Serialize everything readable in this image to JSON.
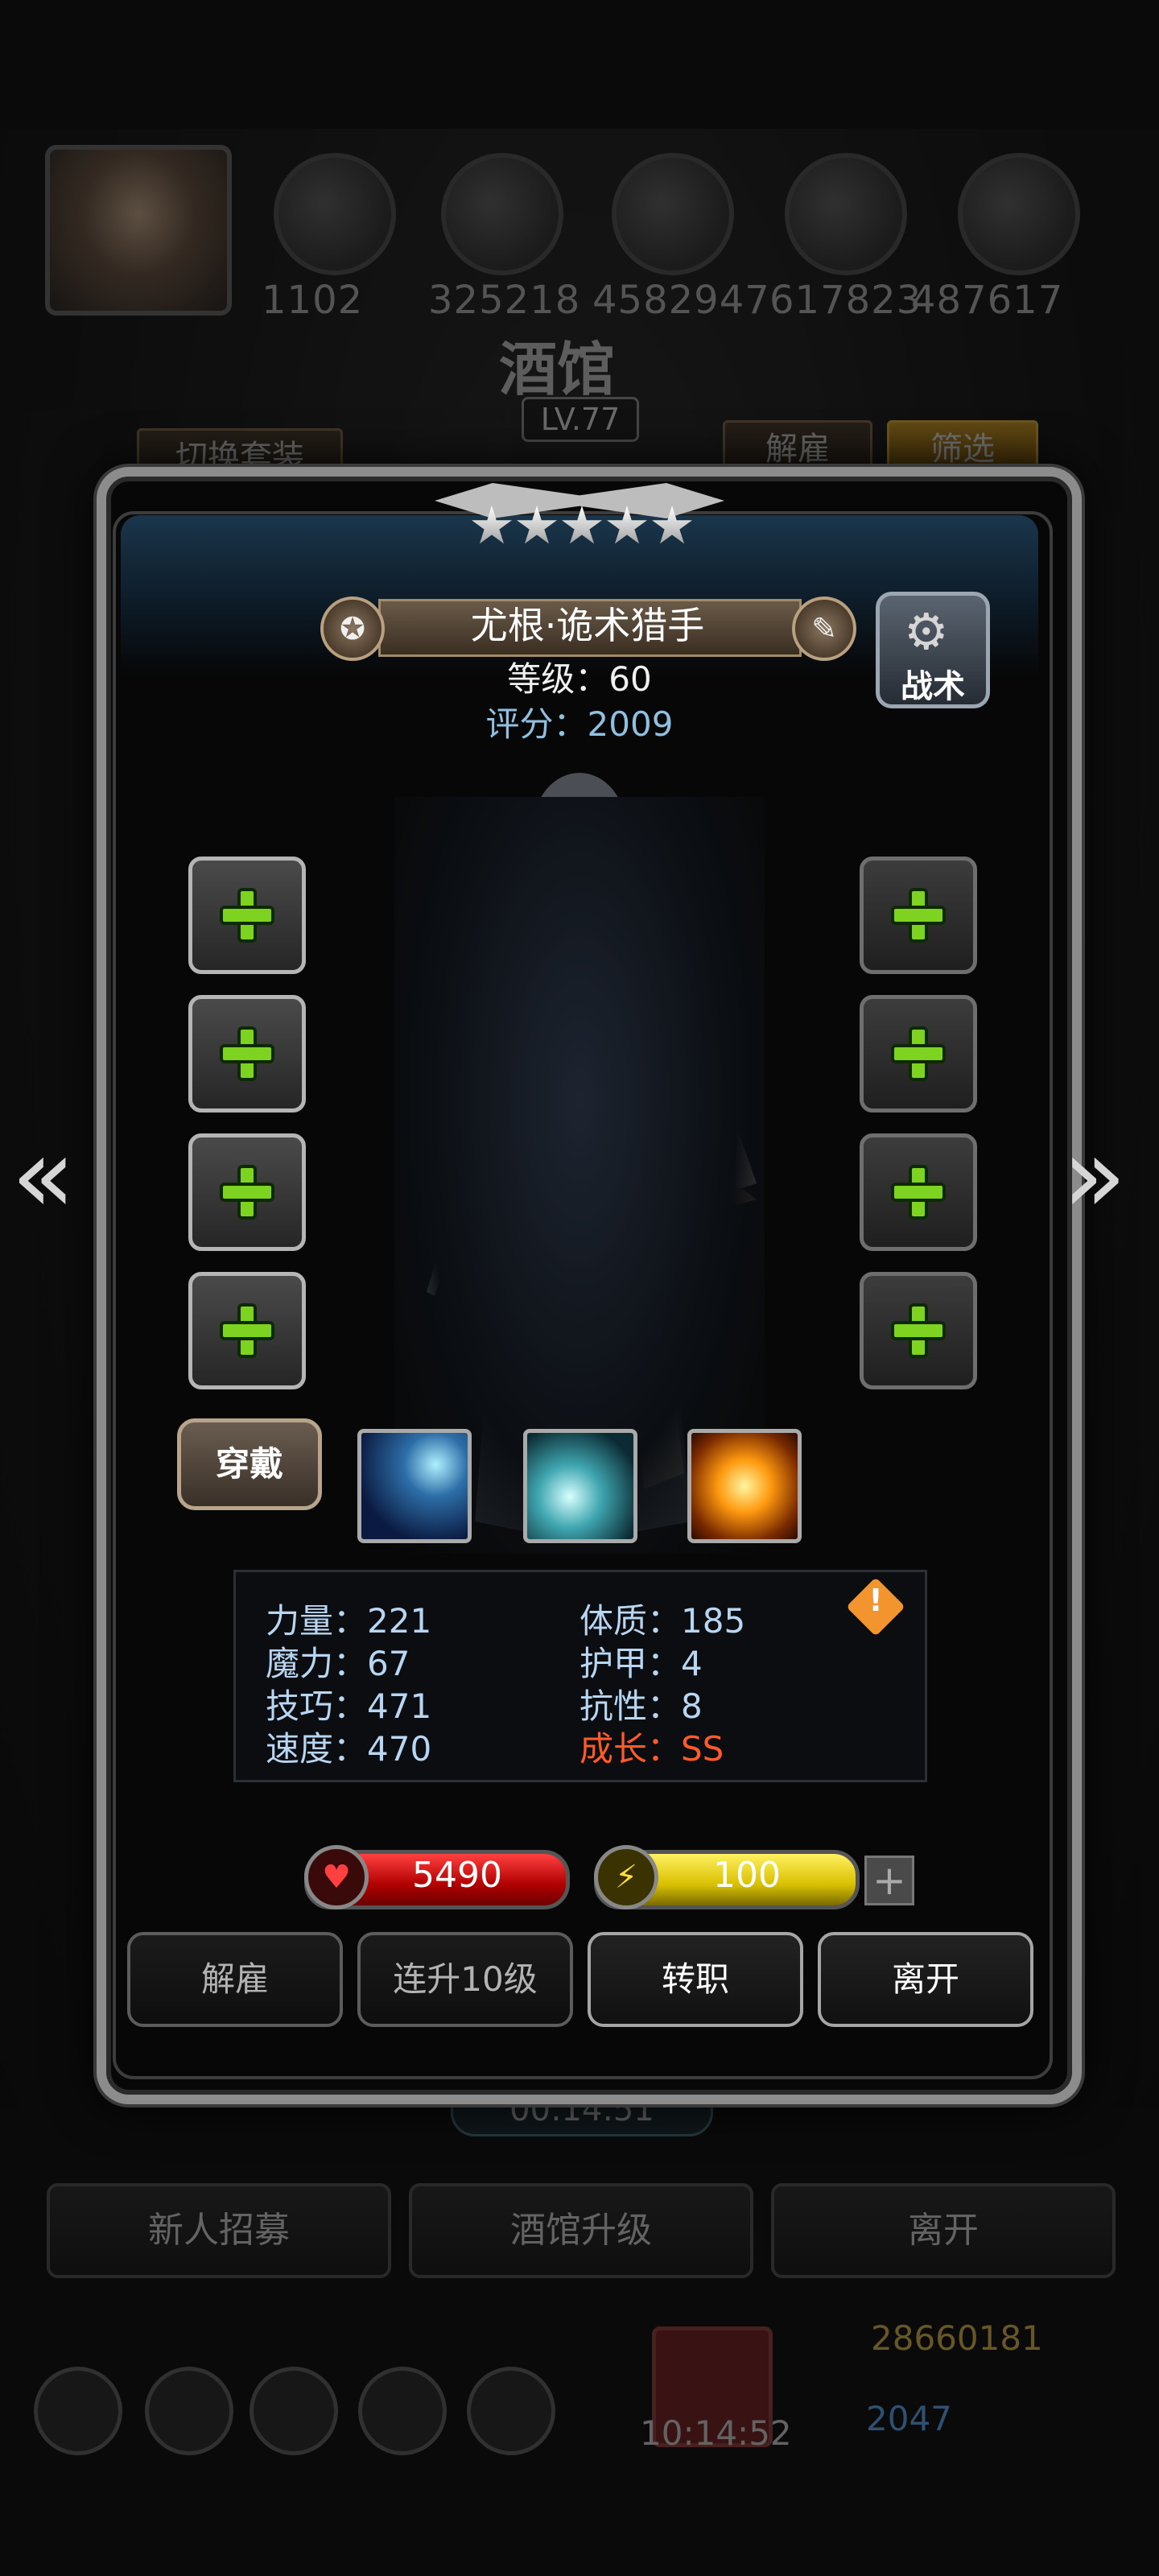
{
  "background": {
    "resources": [
      "1102",
      "325218",
      "4582947",
      "617823",
      "487617"
    ],
    "title": "酒馆",
    "level": "LV.77",
    "switch_set_label": "切换套装",
    "dismiss_label": "解雇",
    "filter_label": "筛选",
    "timer": "00:14:51",
    "bottom_buttons": [
      "新人招募",
      "酒馆升级",
      "离开"
    ],
    "gold": "28660181",
    "gems": "2047",
    "clock": "10:14:52"
  },
  "hero": {
    "stars": 5,
    "name": "尤根·诡术猎手",
    "level_line": "等级：60",
    "score_line": "评分：2009",
    "tactics_label": "战术",
    "wear_label": "穿戴",
    "stats_left": [
      "力量：221",
      "魔力：67",
      "技巧：471",
      "速度：470"
    ],
    "stats_right": [
      "体质：185",
      "护甲：4",
      "抗性：8",
      "成长：SS"
    ],
    "hp": "5490",
    "energy": "100"
  },
  "actions": [
    "解雇",
    "连升10级",
    "转职",
    "离开"
  ],
  "colors": {
    "plus_green": "#7ed321",
    "growth_red": "#ff5a2a",
    "stat_blue": "#b8d6f2",
    "score_blue": "#8fc0e0"
  },
  "icons": {
    "left_arrow": "double-chevron-left-icon",
    "right_arrow": "double-chevron-right-icon",
    "tactics": "gear-icon",
    "hp": "heart-icon",
    "energy": "lightning-icon",
    "warning": "warning-icon"
  }
}
